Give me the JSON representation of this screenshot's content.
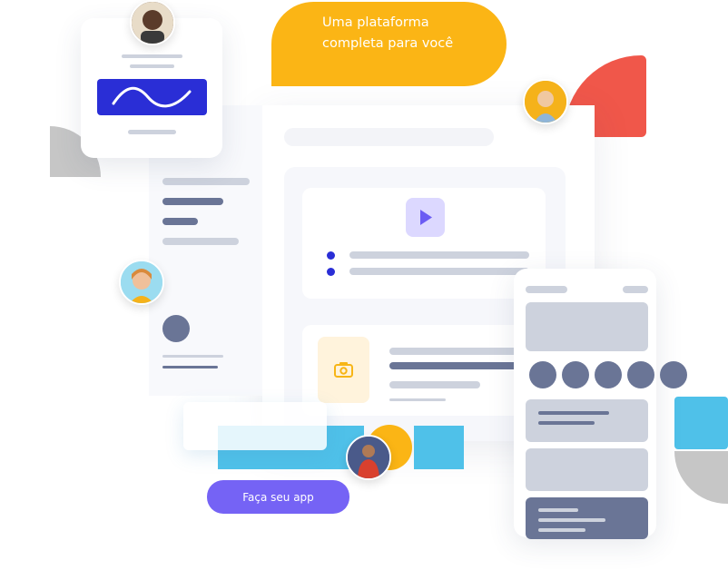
{
  "hero": {
    "bubble_text": "Uma plataforma completa para você",
    "bubble_color": "#fbb515"
  },
  "cta": {
    "label": "Faça seu app",
    "color": "#7563f5"
  },
  "colors": {
    "red": "#f0574a",
    "blue": "#4fc1e9",
    "gray_shape": "#c6c6c6",
    "indigo": "#2a2ed6",
    "bar_light": "#cdd2dd",
    "bar_dark": "#6a7596",
    "play_bg": "#dcd8ff",
    "play_icon": "#6b5cf3",
    "camera_bg": "#fff3dc",
    "camera_icon": "#f7b516"
  },
  "icons": {
    "play": "play-icon",
    "camera": "camera-icon",
    "wave": "wave-icon"
  }
}
